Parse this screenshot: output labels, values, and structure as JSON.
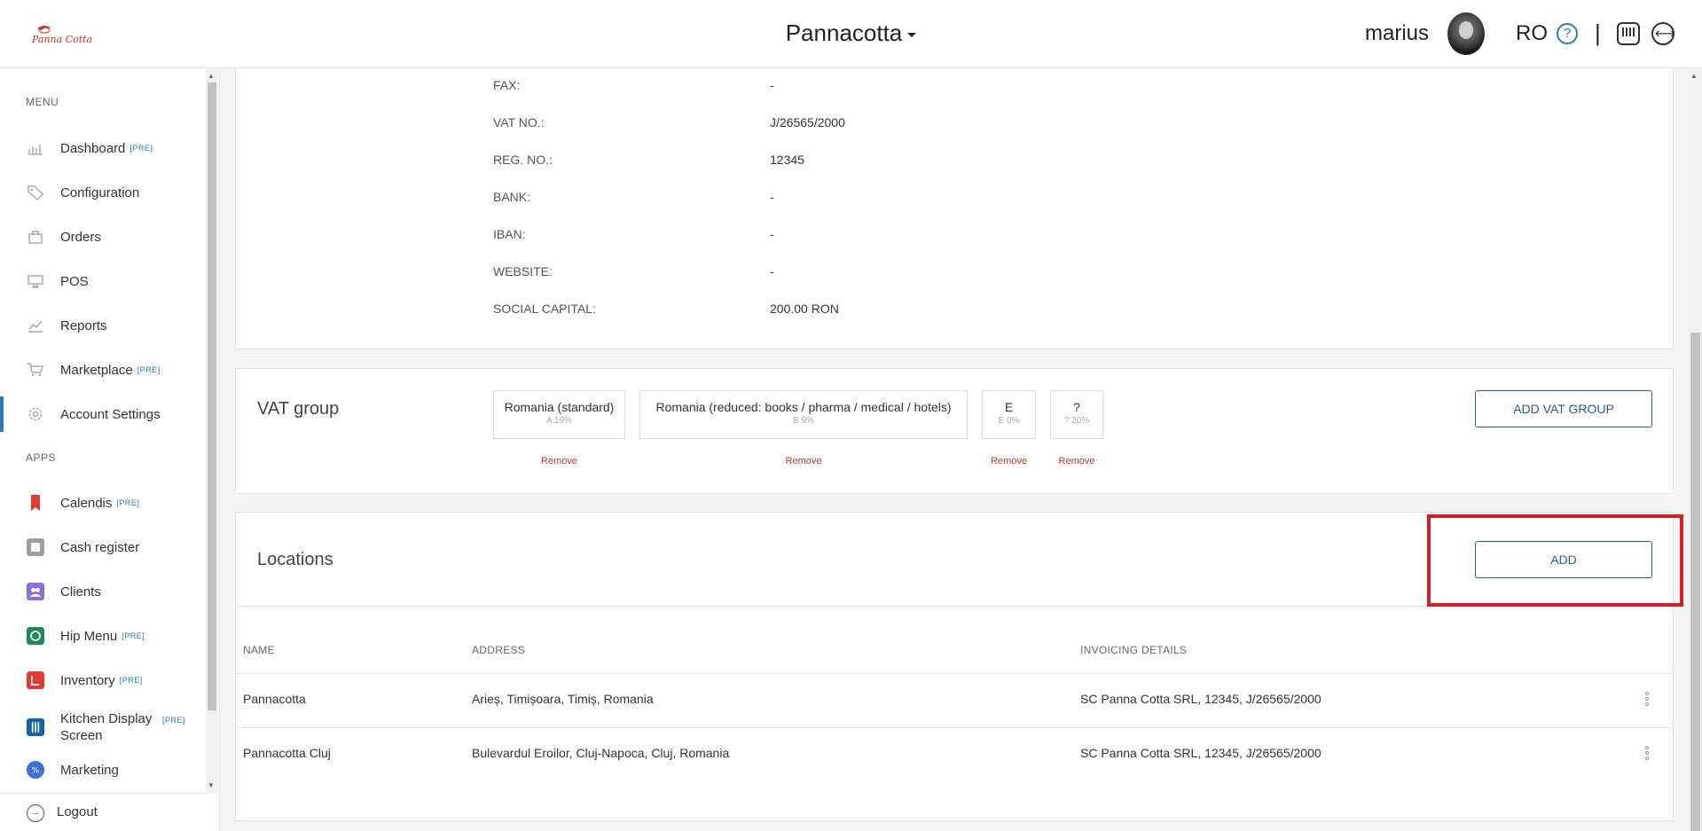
{
  "header": {
    "logo_text": "Panna Cotta",
    "brand": "Pannacotta",
    "user_name": "marius",
    "language": "RO",
    "help_symbol": "?",
    "separator": "|"
  },
  "sidebar": {
    "menu_label": "MENU",
    "apps_label": "APPS",
    "pre_tag": "[PRE]",
    "menu_items": [
      {
        "label": "Dashboard",
        "pre": true,
        "icon": "dashboard-icon"
      },
      {
        "label": "Configuration",
        "pre": false,
        "icon": "tag-icon"
      },
      {
        "label": "Orders",
        "pre": false,
        "icon": "orders-icon"
      },
      {
        "label": "POS",
        "pre": false,
        "icon": "pos-icon"
      },
      {
        "label": "Reports",
        "pre": false,
        "icon": "reports-icon"
      },
      {
        "label": "Marketplace",
        "pre": true,
        "icon": "cart-icon"
      },
      {
        "label": "Account Settings",
        "pre": false,
        "icon": "gear-icon",
        "active": true
      }
    ],
    "app_items": [
      {
        "label": "Calendis",
        "pre": true,
        "icon": "calendis-icon",
        "color": "#e53935"
      },
      {
        "label": "Cash register",
        "pre": false,
        "icon": "cash-register-icon",
        "color": "#9e9e9e"
      },
      {
        "label": "Clients",
        "pre": false,
        "icon": "clients-icon",
        "color": "#8e6ed6"
      },
      {
        "label": "Hip Menu",
        "pre": true,
        "icon": "hip-menu-icon",
        "color": "#1e8a5a"
      },
      {
        "label": "Inventory",
        "pre": true,
        "icon": "inventory-icon",
        "color": "#e53935"
      },
      {
        "label": "Kitchen Display Screen",
        "pre": true,
        "icon": "kitchen-display-icon",
        "color": "#1565a8"
      },
      {
        "label": "Marketing",
        "pre": false,
        "icon": "marketing-icon",
        "color": "#3f6fd6"
      }
    ],
    "logout_label": "Logout"
  },
  "company_info": [
    {
      "label": "FAX:",
      "value": "-"
    },
    {
      "label": "VAT NO.:",
      "value": "J/26565/2000"
    },
    {
      "label": "REG. NO.:",
      "value": "12345"
    },
    {
      "label": "BANK:",
      "value": "-"
    },
    {
      "label": "IBAN:",
      "value": "-"
    },
    {
      "label": "WEBSITE:",
      "value": "-"
    },
    {
      "label": "SOCIAL CAPITAL:",
      "value": "200.00 RON"
    }
  ],
  "vat_group": {
    "title": "VAT group",
    "add_button": "ADD VAT GROUP",
    "remove_label": "Remove",
    "groups": [
      {
        "name": "Romania (standard)",
        "sub": "A 19%"
      },
      {
        "name": "Romania (reduced: books / pharma / medical / hotels)",
        "sub": "B 9%"
      },
      {
        "name": "E",
        "sub": "E 0%"
      },
      {
        "name": "?",
        "sub": "? 20%"
      }
    ]
  },
  "locations": {
    "title": "Locations",
    "add_button": "ADD",
    "columns": [
      "NAME",
      "ADDRESS",
      "INVOICING DETAILS"
    ],
    "rows": [
      {
        "name": "Pannacotta",
        "address": "Arieș, Timișoara, Timiș, Romania",
        "invoicing": "SC Panna Cotta SRL, 12345, J/26565/2000"
      },
      {
        "name": "Pannacotta Cluj",
        "address": "Bulevardul Eroilor, Cluj-Napoca, Cluj, Romania",
        "invoicing": "SC Panna Cotta SRL, 12345, J/26565/2000"
      }
    ]
  },
  "colors": {
    "accent": "#2a7ab9",
    "button_border": "#2a5d8c",
    "remove": "#c0392b",
    "highlight": "#d32027"
  }
}
